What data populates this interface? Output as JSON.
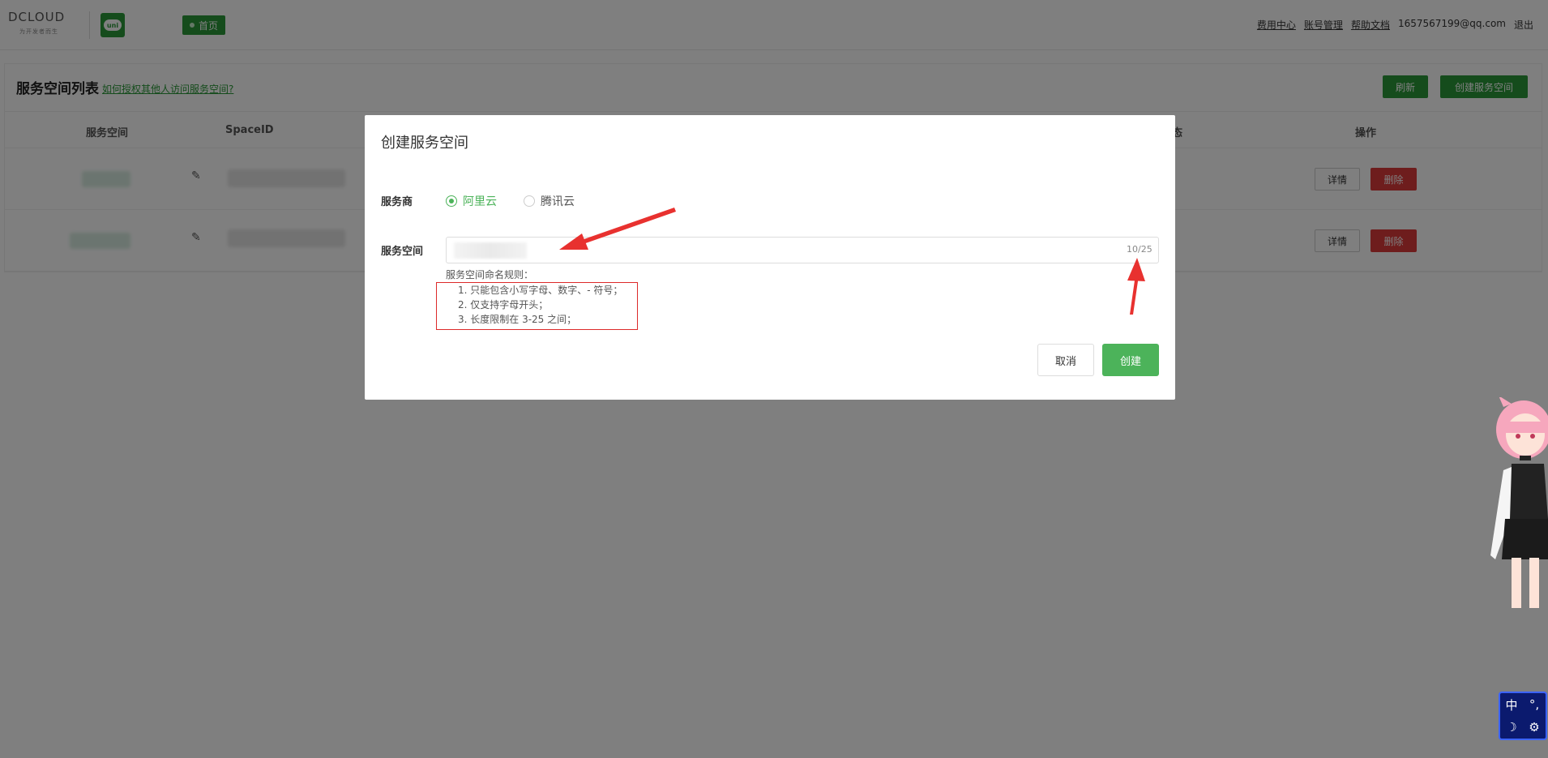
{
  "topbar": {
    "logo_main": "DCLOUD",
    "logo_sub": "为开发者而生",
    "uni_label": "uni",
    "home_label": "首页",
    "links": [
      "费用中心",
      "账号管理",
      "帮助文档"
    ],
    "email": "1657567199@qq.com",
    "logout": "退出"
  },
  "list": {
    "title": "服务空间列表",
    "help_link": "如何授权其他人访问服务空间?",
    "refresh_label": "刷新",
    "create_label": "创建服务空间",
    "columns": [
      "服务空间",
      "SpaceID",
      "态",
      "操作"
    ],
    "rows": [
      {
        "detail": "详情",
        "delete": "删除"
      },
      {
        "detail": "详情",
        "delete": "删除"
      }
    ]
  },
  "modal": {
    "title": "创建服务空间",
    "provider_label": "服务商",
    "providers": [
      {
        "label": "阿里云",
        "checked": true
      },
      {
        "label": "腾讯云",
        "checked": false
      }
    ],
    "space_label": "服务空间",
    "input_value": "",
    "counter": "10/25",
    "rules_title": "服务空间命名规则：",
    "rules": [
      "1. 只能包含小写字母、数字、- 符号；",
      "2. 仅支持字母开头；",
      "3. 长度限制在 3-25 之间；"
    ],
    "cancel_label": "取消",
    "create_label": "创建"
  },
  "ime": {
    "chars": [
      "中",
      "°,",
      "☽",
      "⚙"
    ]
  },
  "colors": {
    "primary_green": "#2b9939",
    "radio_green": "#4cb35a",
    "danger_red": "#dd3a3a",
    "annotation_red": "#e8312f"
  }
}
